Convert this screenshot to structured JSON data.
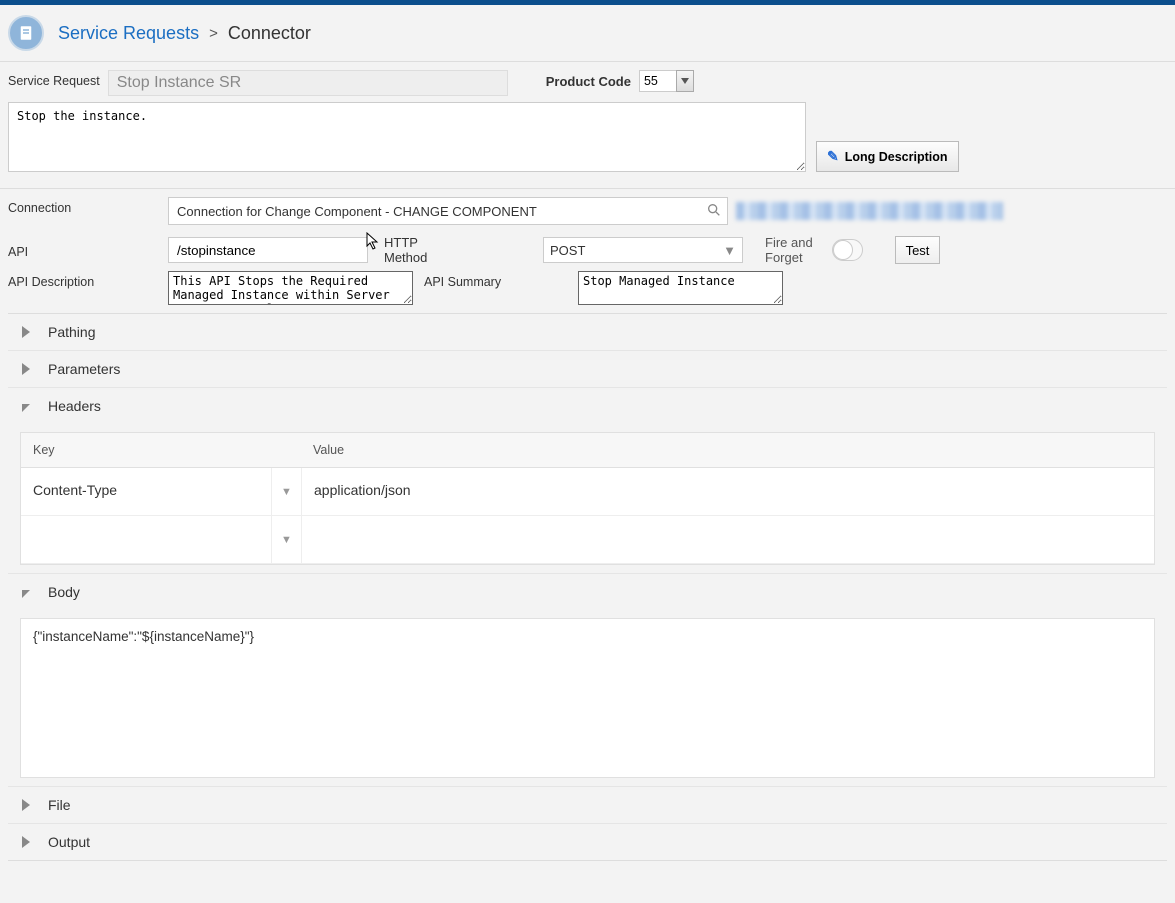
{
  "breadcrumb": {
    "root": "Service Requests",
    "current": "Connector"
  },
  "form": {
    "service_request_label": "Service Request",
    "service_request_value": "Stop Instance SR",
    "product_code_label": "Product Code",
    "product_code_value": "55",
    "short_description": "Stop the instance.",
    "long_description_button": "Long Description",
    "connection_label": "Connection",
    "connection_value": "Connection for Change Component - CHANGE COMPONENT",
    "api_label": "API",
    "api_value": "/stopinstance",
    "http_method_label": "HTTP Method",
    "http_method_value": "POST",
    "fire_and_forget_label": "Fire and Forget",
    "test_button": "Test",
    "api_description_label": "API Description",
    "api_description_value": "This API Stops the Required Managed Instance within Server Manager Console.",
    "api_summary_label": "API Summary",
    "api_summary_value": "Stop Managed Instance"
  },
  "sections": {
    "pathing": "Pathing",
    "parameters": "Parameters",
    "headers": "Headers",
    "body": "Body",
    "file": "File",
    "output": "Output"
  },
  "headers_table": {
    "col_key": "Key",
    "col_value": "Value",
    "rows": [
      {
        "key": "Content-Type",
        "value": "application/json"
      },
      {
        "key": "",
        "value": ""
      }
    ]
  },
  "body_content": "{\"instanceName\":\"${instanceName}\"}"
}
